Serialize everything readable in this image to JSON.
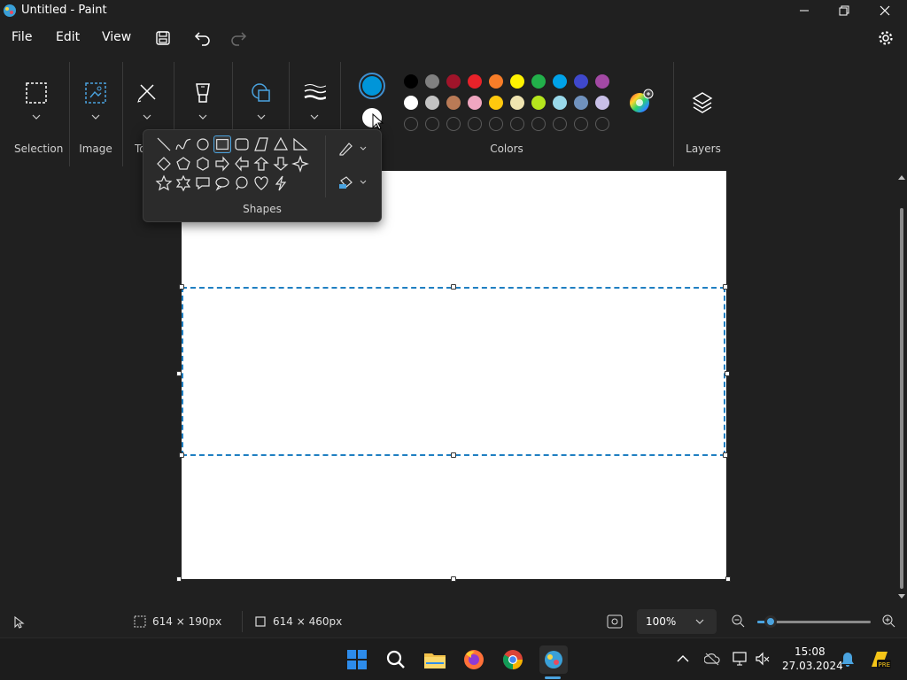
{
  "window": {
    "title": "Untitled - Paint"
  },
  "menu": {
    "file": "File",
    "edit": "Edit",
    "view": "View"
  },
  "ribbon": {
    "selection_label": "Selection",
    "image_label": "Image",
    "tools_label_partial": "To",
    "colors_label": "Colors",
    "layers_label": "Layers",
    "shapes_label": "Shapes"
  },
  "colors": {
    "primary": "#0095d9",
    "secondary": "#ffffff",
    "row1": [
      "#000000",
      "#808080",
      "#a0142a",
      "#e8222a",
      "#f77d28",
      "#fef200",
      "#22b04a",
      "#00a2e8",
      "#3f48cc",
      "#a349a4"
    ],
    "row2": [
      "#ffffff",
      "#c3c3c3",
      "#b97a56",
      "#f0a6c0",
      "#ffc90e",
      "#efe4b0",
      "#b5e61d",
      "#99d9ea",
      "#7092be",
      "#c8bfe7"
    ]
  },
  "status": {
    "selection_size": "614 × 190px",
    "canvas_size": "614 × 460px",
    "zoom": "100%",
    "zoom_level": 0.12
  },
  "taskbar": {
    "time": "15:08",
    "date": "27.03.2024"
  }
}
